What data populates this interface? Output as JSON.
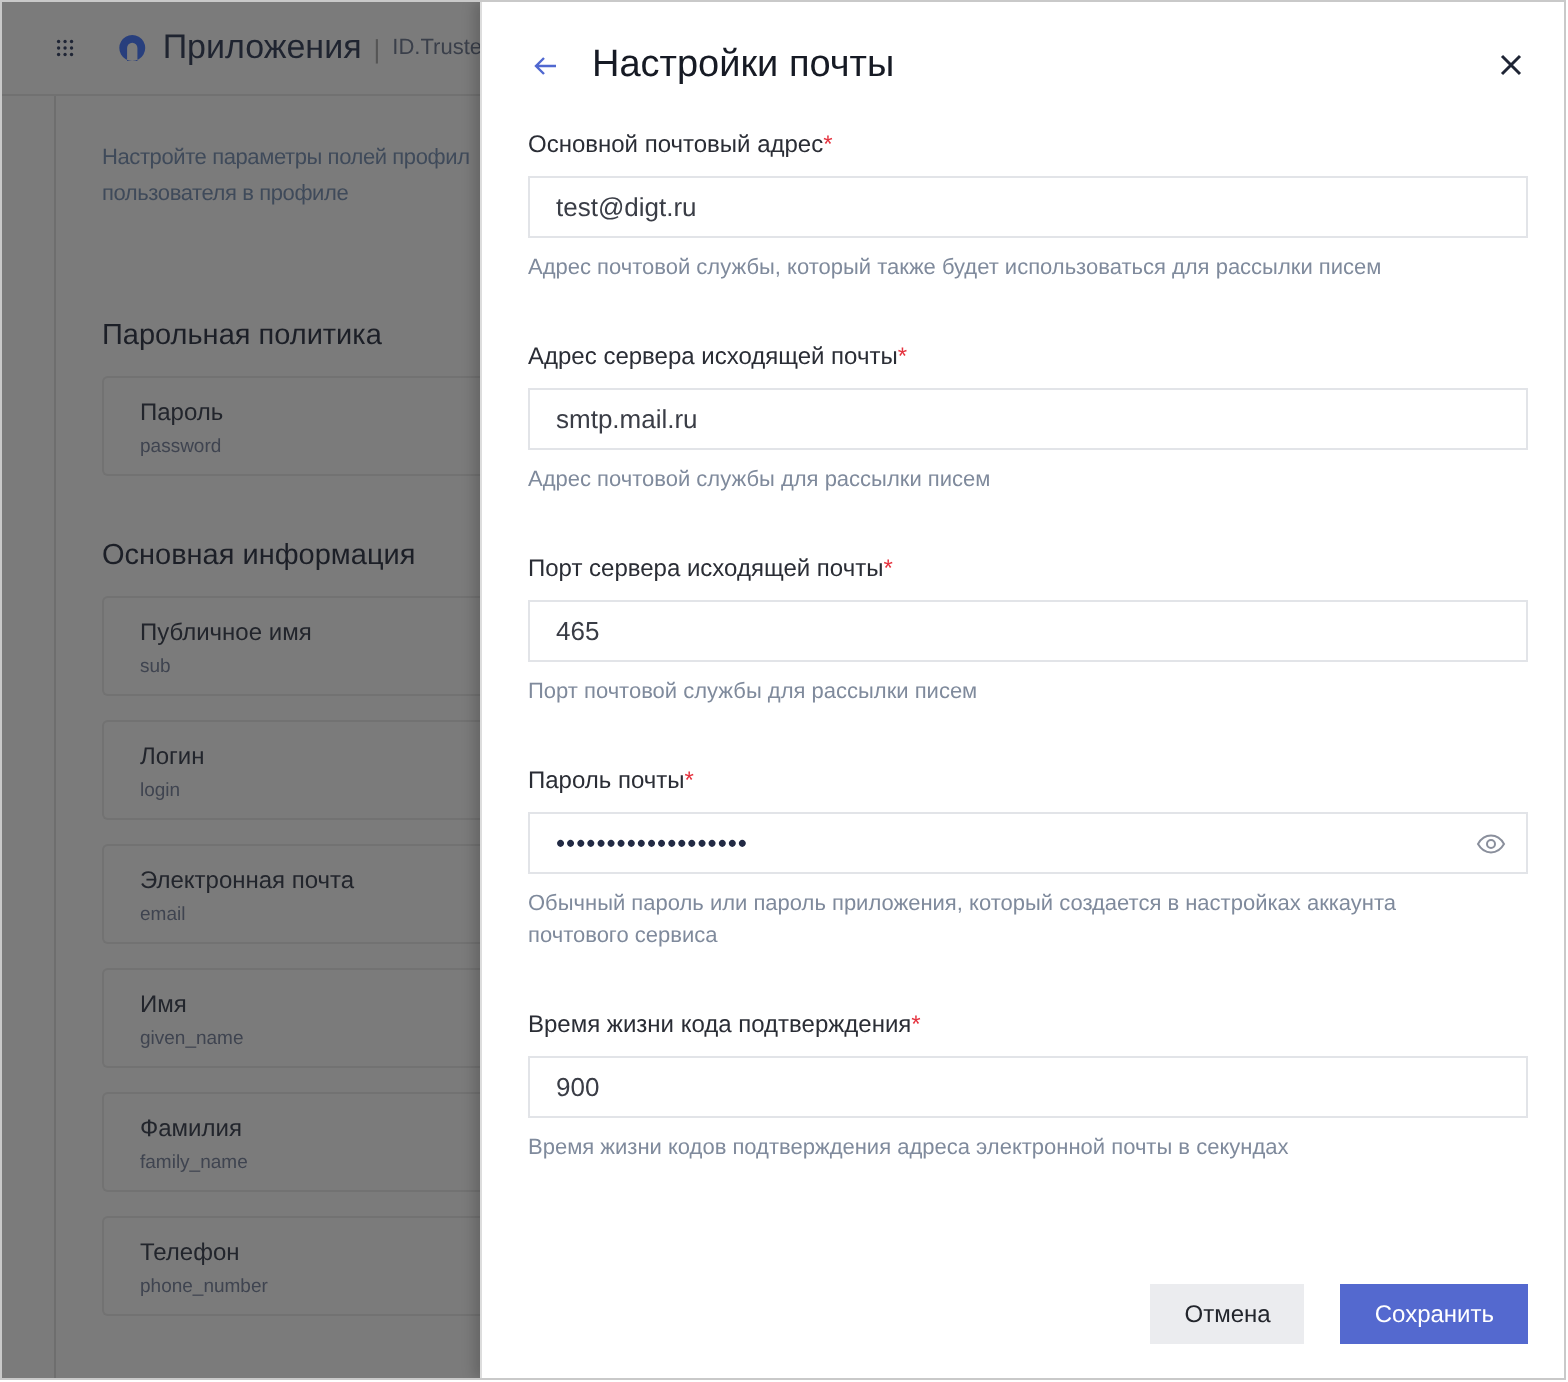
{
  "app_header": {
    "title": "Приложения",
    "separator": "|",
    "subtitle": "ID.Truste"
  },
  "background_page": {
    "description": [
      "Настройте параметры полей профил",
      "пользователя в профиле"
    ],
    "sections": [
      {
        "title": "Парольная политика",
        "cards": [
          {
            "label": "Пароль",
            "key": "password"
          }
        ]
      },
      {
        "title": "Основная информация",
        "cards": [
          {
            "label": "Публичное имя",
            "key": "sub"
          },
          {
            "label": "Логин",
            "key": "login"
          },
          {
            "label": "Электронная почта",
            "key": "email"
          },
          {
            "label": "Имя",
            "key": "given_name"
          },
          {
            "label": "Фамилия",
            "key": "family_name"
          },
          {
            "label": "Телефон",
            "key": "phone_number"
          }
        ]
      }
    ]
  },
  "drawer": {
    "title": "Настройки почты",
    "required_mark": "*",
    "fields": [
      {
        "kind": "text",
        "label": "Основной почтовый адрес",
        "required": true,
        "value": "test@digt.ru",
        "hint": "Адрес почтовой службы, который также будет использоваться для рассылки писем"
      },
      {
        "kind": "text",
        "label": "Адрес сервера исходящей почты",
        "required": true,
        "value": "smtp.mail.ru",
        "hint": "Адрес почтовой службы для рассылки писем"
      },
      {
        "kind": "text",
        "label": "Порт сервера исходящей почты",
        "required": true,
        "value": "465",
        "hint": "Порт почтовой службы для рассылки писем"
      },
      {
        "kind": "password",
        "label": "Пароль почты",
        "required": true,
        "value": "•••••••••••••••••••",
        "hint": "Обычный пароль или пароль приложения, который создается в настройках аккаунта почтового сервиса"
      },
      {
        "kind": "text",
        "label": "Время жизни кода подтверждения",
        "required": true,
        "value": "900",
        "hint": "Время жизни кодов подтверждения адреса электронной почты в секундах"
      }
    ],
    "buttons": [
      {
        "kind": "secondary",
        "label": "Отмена"
      },
      {
        "kind": "primary",
        "label": "Сохранить"
      }
    ]
  }
}
